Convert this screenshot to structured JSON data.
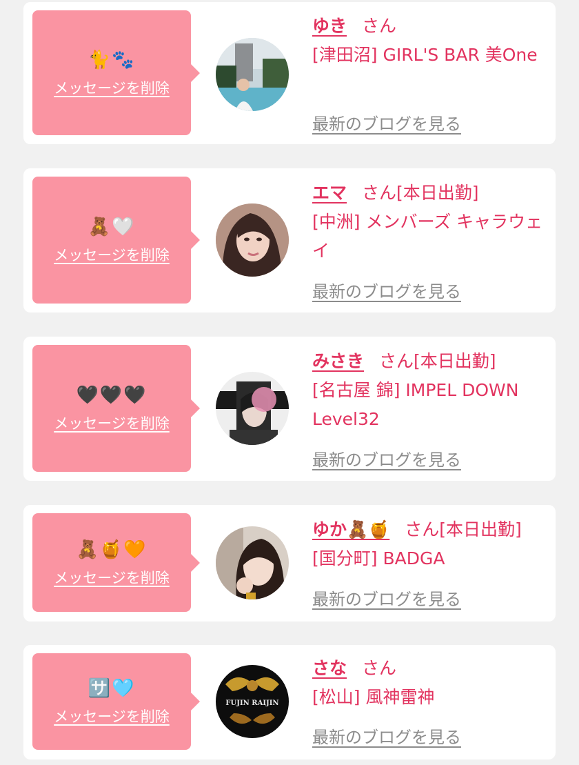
{
  "cards": [
    {
      "bubble_message": "🐈🐾",
      "delete_label": "メッセージを削除",
      "name": "ゆき",
      "honorific": "さん",
      "status": "",
      "shop": "[津田沼] GIRL'S BAR 美One",
      "blog_label": "最新のブログを見る"
    },
    {
      "bubble_message": "🧸🤍",
      "delete_label": "メッセージを削除",
      "name": "エマ",
      "honorific": "さん",
      "status": "[本日出勤]",
      "shop": "[中洲] メンバーズ キャラウェイ",
      "blog_label": "最新のブログを見る"
    },
    {
      "bubble_message": "🖤🖤🖤",
      "delete_label": "メッセージを削除",
      "name": "みさき",
      "honorific": "さん",
      "status": "[本日出勤]",
      "shop": "[名古屋 錦] IMPEL DOWN Level32",
      "blog_label": "最新のブログを見る"
    },
    {
      "bubble_message": "🧸🍯🧡",
      "delete_label": "メッセージを削除",
      "name": "ゆか🧸🍯",
      "honorific": "さん",
      "status": "[本日出勤]",
      "shop": "[国分町] BADGA",
      "blog_label": "最新のブログを見る"
    },
    {
      "bubble_message": "🈂️🩵",
      "delete_label": "メッセージを削除",
      "name": "さな",
      "honorific": "さん",
      "status": "",
      "shop": "[松山] 風神雷神",
      "blog_label": "最新のブログを見る"
    }
  ],
  "avatar_logo_text": "FUJIN RAIJIN",
  "colors": {
    "accent": "#e2335f",
    "bubble": "#fa94a2",
    "background": "#f1f1f1",
    "muted": "#8c8c8c"
  }
}
